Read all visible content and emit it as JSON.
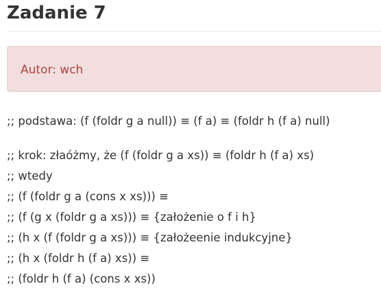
{
  "page": {
    "title": "Zadanie 7"
  },
  "alert": {
    "text": "Autor: wch"
  },
  "proof": {
    "base_line": ";; podstawa: (f (foldr g a null)) ≡ (f a) ≡ (foldr h (f a) null)",
    "step_lines": [
      ";; krok: złaóżmy, że (f (foldr g a xs)) ≡ (foldr h (f a) xs)",
      ";; wtedy",
      ";; (f (foldr g a (cons x xs))) ≡",
      ";; (f (g x (foldr g a xs))) ≡ {założenie o f i h}",
      ";; (h x (f (foldr g a xs))) ≡ {założeenie indukcyjne}",
      ";; (h x (foldr h (f a) xs)) ≡",
      ";; (foldr h (f a) (cons x xs))"
    ]
  }
}
